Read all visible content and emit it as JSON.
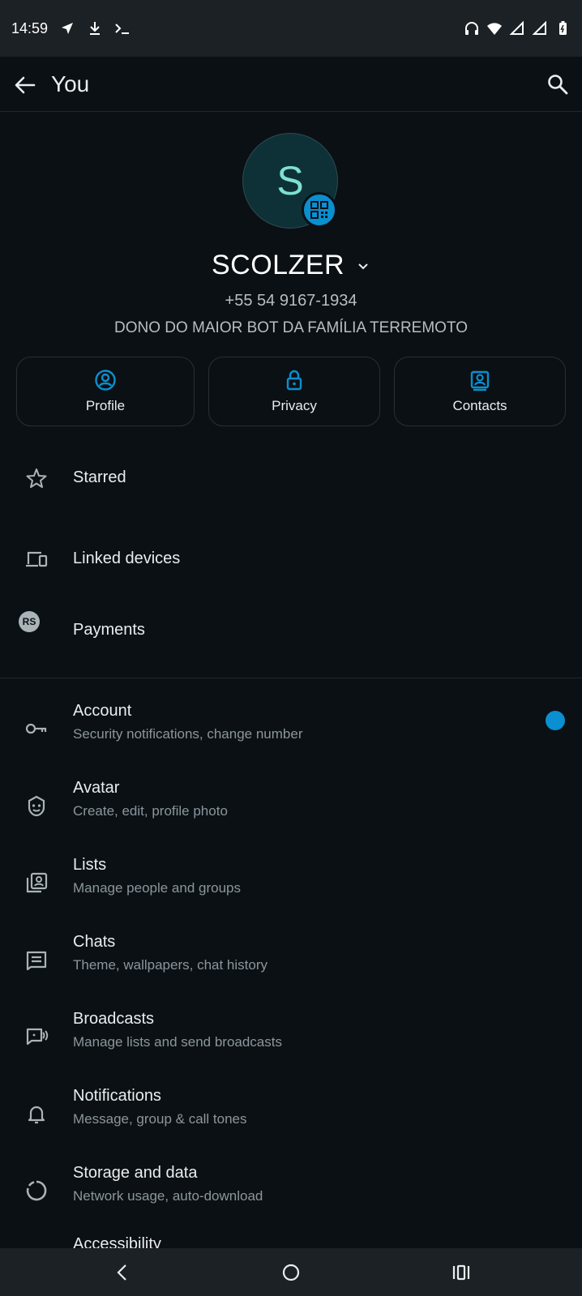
{
  "status": {
    "time": "14:59"
  },
  "header": {
    "title": "You"
  },
  "profile": {
    "initial": "S",
    "name": "SCOLZER",
    "phone": "+55 54 9167-1934",
    "about": "DONO DO MAIOR BOT DA FAMÍLIA TERREMOTO"
  },
  "quick_actions": [
    {
      "label": "Profile",
      "icon": "profile-circle-icon"
    },
    {
      "label": "Privacy",
      "icon": "lock-icon"
    },
    {
      "label": "Contacts",
      "icon": "contacts-icon"
    }
  ],
  "menu_top": [
    {
      "label": "Starred",
      "icon": "star-icon"
    },
    {
      "label": "Linked devices",
      "icon": "devices-icon"
    },
    {
      "label": "Payments",
      "icon": "payments-rs-icon",
      "icon_text": "RS"
    }
  ],
  "menu_settings": [
    {
      "label": "Account",
      "sub": "Security notifications, change number",
      "icon": "key-icon"
    },
    {
      "label": "Avatar",
      "sub": "Create, edit, profile photo",
      "icon": "avatar-face-icon"
    },
    {
      "label": "Lists",
      "sub": "Manage people and groups",
      "icon": "lists-icon"
    },
    {
      "label": "Chats",
      "sub": "Theme, wallpapers, chat history",
      "icon": "chat-icon"
    },
    {
      "label": "Broadcasts",
      "sub": "Manage lists and send broadcasts",
      "icon": "broadcast-icon"
    },
    {
      "label": "Notifications",
      "sub": "Message, group & call tones",
      "icon": "bell-icon"
    },
    {
      "label": "Storage and data",
      "sub": "Network usage, auto-download",
      "icon": "storage-circle-icon"
    },
    {
      "label": "Accessibility",
      "icon": "accessibility-icon"
    }
  ],
  "colors": {
    "accent": "#0a8fd0",
    "background": "#0b1014",
    "bar": "#1b2125"
  }
}
